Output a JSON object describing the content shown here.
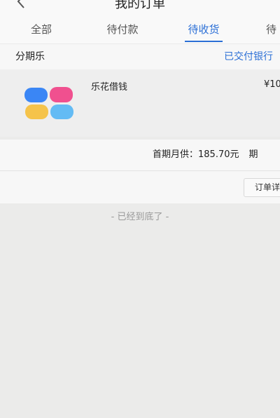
{
  "header": {
    "title": "我的订单",
    "back_icon": "chevron-left-icon"
  },
  "tabs": [
    {
      "label": "全部",
      "active": false
    },
    {
      "label": "待付款",
      "active": false
    },
    {
      "label": "待收货",
      "active": true
    },
    {
      "label": "待",
      "active": false
    }
  ],
  "order": {
    "shop_name": "分期乐",
    "status": "已交付银行",
    "product_name": "乐花借钱",
    "price": "¥10",
    "summary_label": "首期月供：",
    "summary_value": "185.70元",
    "summary_extra": "期",
    "action_label": "订单详"
  },
  "footer": {
    "end_text": "- 已经到底了 -"
  },
  "colors": {
    "accent": "#2b6fd6",
    "logo_blue": "#3a86f5",
    "logo_pink": "#f0508f",
    "logo_yellow": "#f5c34a",
    "logo_lightblue": "#63bbf4"
  }
}
